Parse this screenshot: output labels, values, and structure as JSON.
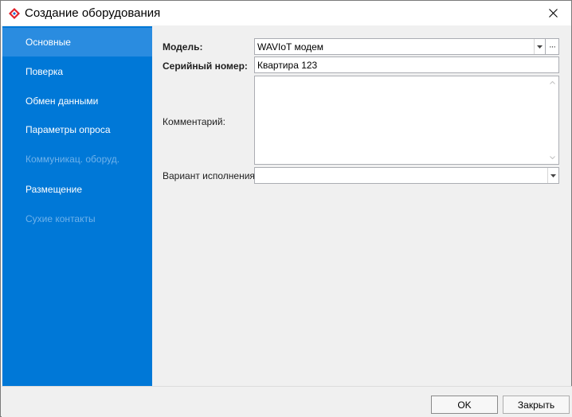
{
  "window": {
    "title": "Создание оборудования",
    "close_glyph": "×"
  },
  "sidebar": {
    "items": [
      {
        "label": "Основные",
        "state": "active"
      },
      {
        "label": "Поверка",
        "state": "normal"
      },
      {
        "label": "Обмен данными",
        "state": "normal"
      },
      {
        "label": "Параметры опроса",
        "state": "normal"
      },
      {
        "label": "Коммуникац. оборуд.",
        "state": "disabled"
      },
      {
        "label": "Размещение",
        "state": "normal"
      },
      {
        "label": "Сухие контакты",
        "state": "disabled"
      }
    ]
  },
  "form": {
    "model": {
      "label": "Модель:",
      "value": "WAVIoT модем"
    },
    "serial": {
      "label": "Серийный номер:",
      "value": "Квартира 123"
    },
    "comment": {
      "label": "Комментарий:",
      "value": ""
    },
    "variant": {
      "label": "Вариант исполнения:",
      "value": ""
    }
  },
  "buttons": {
    "ok_label": "OK",
    "close_label": "Закрыть"
  },
  "colors": {
    "sidebar_bg": "#0078d7",
    "sidebar_active": "#2a8ce0",
    "sidebar_disabled_text": "#6fb2ea"
  },
  "icons": {
    "app": "app-logo-icon",
    "close": "close-icon",
    "dropdown": "chevron-down-icon",
    "browse": "ellipsis-icon",
    "scroll_up": "scroll-up-icon",
    "scroll_down": "scroll-down-icon"
  }
}
